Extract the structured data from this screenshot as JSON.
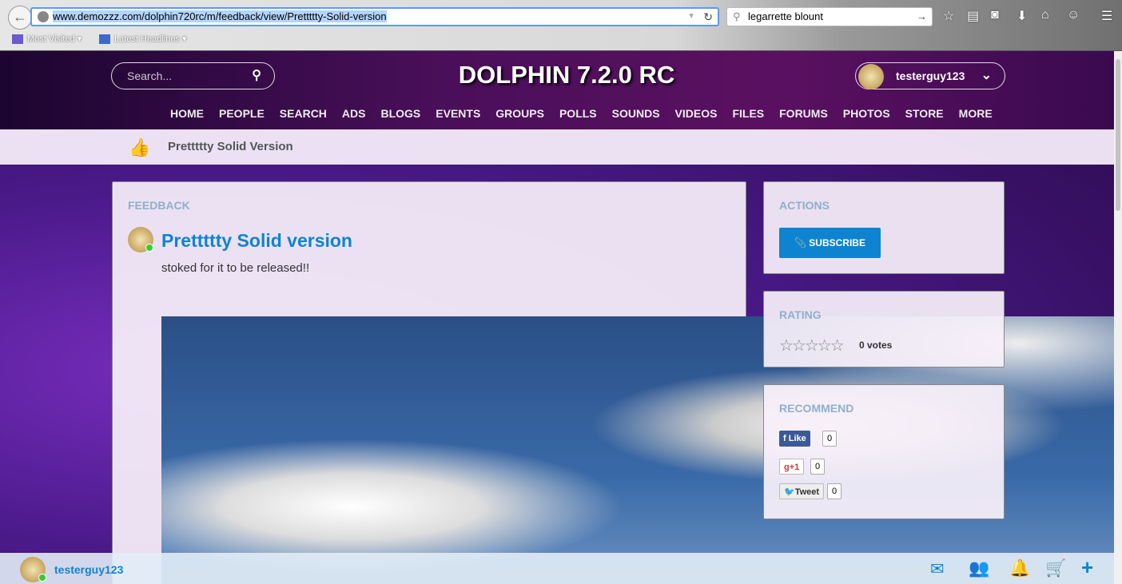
{
  "browser": {
    "url": "www.demozzz.com/dolphin720rc/m/feedback/view/Prettttty-Solid-version",
    "search_value": "legarrette blount",
    "bookmarks": [
      "Most Visited",
      "Latest Headlines"
    ]
  },
  "header": {
    "search_placeholder": "Search...",
    "site_title": "DOLPHIN 7.2.0 RC",
    "username": "testerguy123",
    "nav": [
      "HOME",
      "PEOPLE",
      "SEARCH",
      "ADS",
      "BLOGS",
      "EVENTS",
      "GROUPS",
      "POLLS",
      "SOUNDS",
      "VIDEOS",
      "FILES",
      "FORUMS",
      "PHOTOS",
      "STORE",
      "MORE"
    ]
  },
  "subheader": {
    "title": "Prettttty Solid Version"
  },
  "post": {
    "section": "FEEDBACK",
    "title": "Prettttty Solid version",
    "body": "stoked for it to be released!!"
  },
  "actions": {
    "title": "ACTIONS",
    "subscribe": "SUBSCRIBE"
  },
  "rating": {
    "title": "RATING",
    "stars": "☆☆☆☆☆",
    "value": 0,
    "votes": "0 votes"
  },
  "recommend": {
    "title": "RECOMMEND",
    "facebook": {
      "label": "Like",
      "count": "0"
    },
    "gplus": {
      "label": "+1",
      "count": "0"
    },
    "twitter": {
      "label": "Tweet",
      "count": "0"
    }
  },
  "footer": {
    "username": "testerguy123"
  }
}
